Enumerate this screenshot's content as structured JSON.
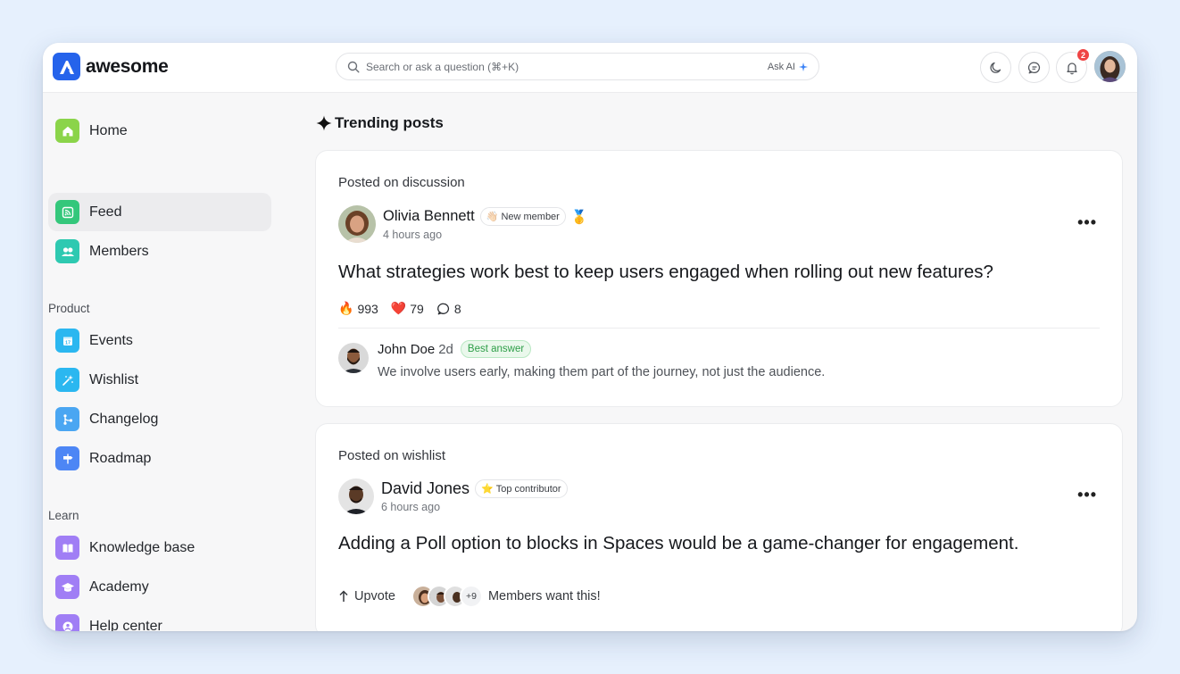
{
  "app": {
    "name": "awesome",
    "brand_color": "#2563eb"
  },
  "header": {
    "search_placeholder": "Search or ask a question (⌘+K)",
    "ask_ai_label": "Ask AI",
    "notification_count": "2",
    "icons": [
      "moon-icon",
      "chat-icon",
      "bell-icon"
    ]
  },
  "sidebar": {
    "items": [
      {
        "label": "Home",
        "icon": "home-icon",
        "color": "#8bd44a",
        "active": false
      },
      {
        "label": "Feed",
        "icon": "rss-icon",
        "color": "#34c77b",
        "active": true
      },
      {
        "label": "Members",
        "icon": "users-icon",
        "color": "#2ec9b1",
        "active": false
      }
    ],
    "product_label": "Product",
    "product_items": [
      {
        "label": "Events",
        "icon": "calendar-icon",
        "color": "#2bb7f0"
      },
      {
        "label": "Wishlist",
        "icon": "wand-icon",
        "color": "#2bb7f0"
      },
      {
        "label": "Changelog",
        "icon": "branch-icon",
        "color": "#4aa6f2"
      },
      {
        "label": "Roadmap",
        "icon": "signpost-icon",
        "color": "#4d86f5"
      }
    ],
    "learn_label": "Learn",
    "learn_items": [
      {
        "label": "Knowledge base",
        "icon": "book-icon",
        "color": "#a07ef5"
      },
      {
        "label": "Academy",
        "icon": "graduation-cap-icon",
        "color": "#a07ef5"
      },
      {
        "label": "Help center",
        "icon": "lifebuoy-icon",
        "color": "#a07ef5"
      }
    ]
  },
  "main": {
    "section_title": "Trending posts",
    "posts": [
      {
        "posted_on": "Posted on discussion",
        "author": "Olivia Bennett",
        "badge": "New member",
        "badge_icon": "👋🏻",
        "medal": "🥇",
        "time": "4 hours ago",
        "title": "What strategies work best to keep users engaged when rolling out new features?",
        "reactions": [
          {
            "icon": "🔥",
            "count": "993"
          },
          {
            "icon": "❤️",
            "count": "79"
          },
          {
            "icon": "comment-icon",
            "count": "8"
          }
        ],
        "reply": {
          "author": "John Doe",
          "time": "2d",
          "badge": "Best answer",
          "text": "We involve users early, making them part of the journey, not just the audience."
        }
      },
      {
        "posted_on": "Posted on wishlist",
        "author": "David Jones",
        "badge": "Top contributor",
        "badge_icon": "⭐",
        "time": "6 hours ago",
        "title": "Adding a Poll option to blocks in Spaces would be a game-changer for engagement.",
        "upvote_label": "Upvote",
        "more_count": "+9",
        "members_text": "Members want this!"
      }
    ]
  }
}
